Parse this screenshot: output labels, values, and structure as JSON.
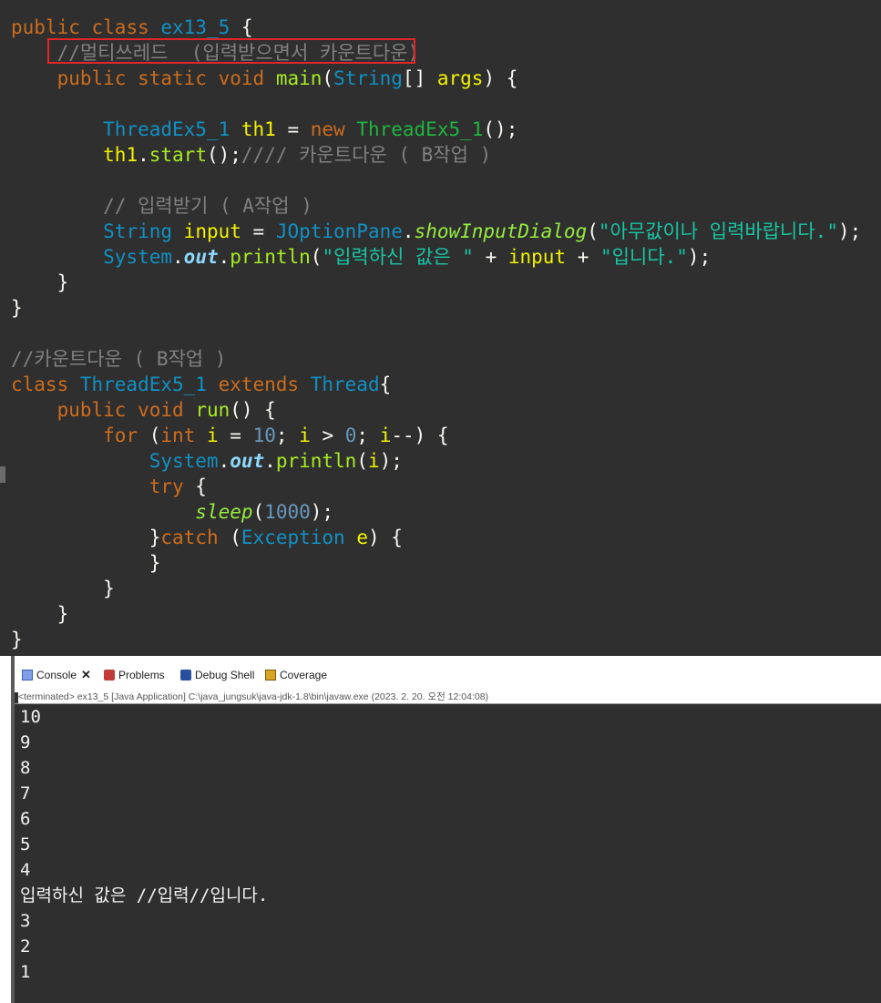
{
  "editor": {
    "lines": [
      [
        {
          "c": "kw",
          "t": "public "
        },
        {
          "c": "kw",
          "t": "class "
        },
        {
          "c": "ty",
          "t": "ex13_5"
        },
        {
          "c": "plain",
          "t": " {"
        }
      ],
      [
        {
          "c": "comment",
          "t": "    //멀티쓰레드  (입력받으면서 카운트다운)"
        }
      ],
      [
        {
          "c": "plain",
          "t": "    "
        },
        {
          "c": "kw",
          "t": "public "
        },
        {
          "c": "kw",
          "t": "static "
        },
        {
          "c": "kw",
          "t": "void "
        },
        {
          "c": "fn",
          "t": "main"
        },
        {
          "c": "plain",
          "t": "("
        },
        {
          "c": "ty",
          "t": "String"
        },
        {
          "c": "plain",
          "t": "[] "
        },
        {
          "c": "var",
          "t": "args"
        },
        {
          "c": "plain",
          "t": ") {"
        }
      ],
      [
        {
          "c": "plain",
          "t": ""
        }
      ],
      [
        {
          "c": "plain",
          "t": "        "
        },
        {
          "c": "ty",
          "t": "ThreadEx5_1 "
        },
        {
          "c": "var",
          "t": "th1"
        },
        {
          "c": "plain",
          "t": " = "
        },
        {
          "c": "kw",
          "t": "new "
        },
        {
          "c": "cls",
          "t": "ThreadEx5_1"
        },
        {
          "c": "plain",
          "t": "();"
        }
      ],
      [
        {
          "c": "plain",
          "t": "        "
        },
        {
          "c": "var",
          "t": "th1"
        },
        {
          "c": "plain",
          "t": "."
        },
        {
          "c": "fn",
          "t": "start"
        },
        {
          "c": "plain",
          "t": "();"
        },
        {
          "c": "comment",
          "t": "//// 카운트다운 ( B작업 )"
        }
      ],
      [
        {
          "c": "plain",
          "t": ""
        }
      ],
      [
        {
          "c": "comment",
          "t": "        // 입력받기 ( A작업 )"
        }
      ],
      [
        {
          "c": "plain",
          "t": "        "
        },
        {
          "c": "ty",
          "t": "String "
        },
        {
          "c": "var",
          "t": "input"
        },
        {
          "c": "plain",
          "t": " = "
        },
        {
          "c": "ty",
          "t": "JOptionPane"
        },
        {
          "c": "plain",
          "t": "."
        },
        {
          "c": "static-fn",
          "t": "showInputDialog"
        },
        {
          "c": "plain",
          "t": "("
        },
        {
          "c": "str",
          "t": "\"아무값이나 입력바랍니다.\""
        },
        {
          "c": "plain",
          "t": ");"
        }
      ],
      [
        {
          "c": "plain",
          "t": "        "
        },
        {
          "c": "ty",
          "t": "System"
        },
        {
          "c": "plain",
          "t": "."
        },
        {
          "c": "field",
          "t": "out"
        },
        {
          "c": "plain",
          "t": "."
        },
        {
          "c": "fn",
          "t": "println"
        },
        {
          "c": "plain",
          "t": "("
        },
        {
          "c": "str",
          "t": "\"입력하신 값은 \""
        },
        {
          "c": "plain",
          "t": " + "
        },
        {
          "c": "var",
          "t": "input"
        },
        {
          "c": "plain",
          "t": " + "
        },
        {
          "c": "str",
          "t": "\"입니다.\""
        },
        {
          "c": "plain",
          "t": ");"
        }
      ],
      [
        {
          "c": "plain",
          "t": "    }"
        }
      ],
      [
        {
          "c": "plain",
          "t": "}"
        }
      ],
      [
        {
          "c": "plain",
          "t": ""
        }
      ],
      [
        {
          "c": "comment",
          "t": "//카운트다운 ( B작업 )"
        }
      ],
      [
        {
          "c": "kw",
          "t": "class "
        },
        {
          "c": "ty",
          "t": "ThreadEx5_1 "
        },
        {
          "c": "kw",
          "t": "extends "
        },
        {
          "c": "ty",
          "t": "Thread"
        },
        {
          "c": "plain",
          "t": "{"
        }
      ],
      [
        {
          "c": "plain",
          "t": "    "
        },
        {
          "c": "kw",
          "t": "public "
        },
        {
          "c": "kw",
          "t": "void "
        },
        {
          "c": "fn",
          "t": "run"
        },
        {
          "c": "plain",
          "t": "() {"
        }
      ],
      [
        {
          "c": "plain",
          "t": "        "
        },
        {
          "c": "kw",
          "t": "for "
        },
        {
          "c": "plain",
          "t": "("
        },
        {
          "c": "kw",
          "t": "int "
        },
        {
          "c": "var",
          "t": "i"
        },
        {
          "c": "plain",
          "t": " = "
        },
        {
          "c": "num",
          "t": "10"
        },
        {
          "c": "plain",
          "t": "; "
        },
        {
          "c": "var",
          "t": "i"
        },
        {
          "c": "plain",
          "t": " > "
        },
        {
          "c": "num",
          "t": "0"
        },
        {
          "c": "plain",
          "t": "; "
        },
        {
          "c": "var",
          "t": "i"
        },
        {
          "c": "plain",
          "t": "--) {"
        }
      ],
      [
        {
          "c": "plain",
          "t": "            "
        },
        {
          "c": "ty",
          "t": "System"
        },
        {
          "c": "plain",
          "t": "."
        },
        {
          "c": "field",
          "t": "out"
        },
        {
          "c": "plain",
          "t": "."
        },
        {
          "c": "fn",
          "t": "println"
        },
        {
          "c": "plain",
          "t": "("
        },
        {
          "c": "var",
          "t": "i"
        },
        {
          "c": "plain",
          "t": ");"
        }
      ],
      [
        {
          "c": "plain",
          "t": "            "
        },
        {
          "c": "kw",
          "t": "try "
        },
        {
          "c": "plain",
          "t": "{"
        }
      ],
      [
        {
          "c": "plain",
          "t": "                "
        },
        {
          "c": "static-fn",
          "t": "sleep"
        },
        {
          "c": "plain",
          "t": "("
        },
        {
          "c": "num",
          "t": "1000"
        },
        {
          "c": "plain",
          "t": ");"
        }
      ],
      [
        {
          "c": "plain",
          "t": "            }"
        },
        {
          "c": "kw",
          "t": "catch "
        },
        {
          "c": "plain",
          "t": "("
        },
        {
          "c": "ty",
          "t": "Exception "
        },
        {
          "c": "var",
          "t": "e"
        },
        {
          "c": "plain",
          "t": ") {"
        }
      ],
      [
        {
          "c": "plain",
          "t": "            }"
        }
      ],
      [
        {
          "c": "plain",
          "t": "        }"
        }
      ],
      [
        {
          "c": "plain",
          "t": "    }"
        }
      ],
      [
        {
          "c": "plain",
          "t": "}"
        }
      ]
    ]
  },
  "console": {
    "tabs": [
      {
        "label": "Console",
        "icon": "console-icon",
        "active": true,
        "close": "✕"
      },
      {
        "label": "Problems",
        "icon": "problems-icon"
      },
      {
        "label": "Debug Shell",
        "icon": "debug-shell-icon"
      },
      {
        "label": "Coverage",
        "icon": "coverage-icon"
      }
    ],
    "status": "<terminated> ex13_5 [Java Application] C:\\java_jungsuk\\java-jdk-1.8\\bin\\javaw.exe  (2023. 2. 20. 오전 12:04:08)",
    "output": [
      "10",
      "9",
      "8",
      "7",
      "6",
      "5",
      "4",
      "입력하신 값은 //입력//입니다.",
      "3",
      "2",
      "1"
    ]
  }
}
